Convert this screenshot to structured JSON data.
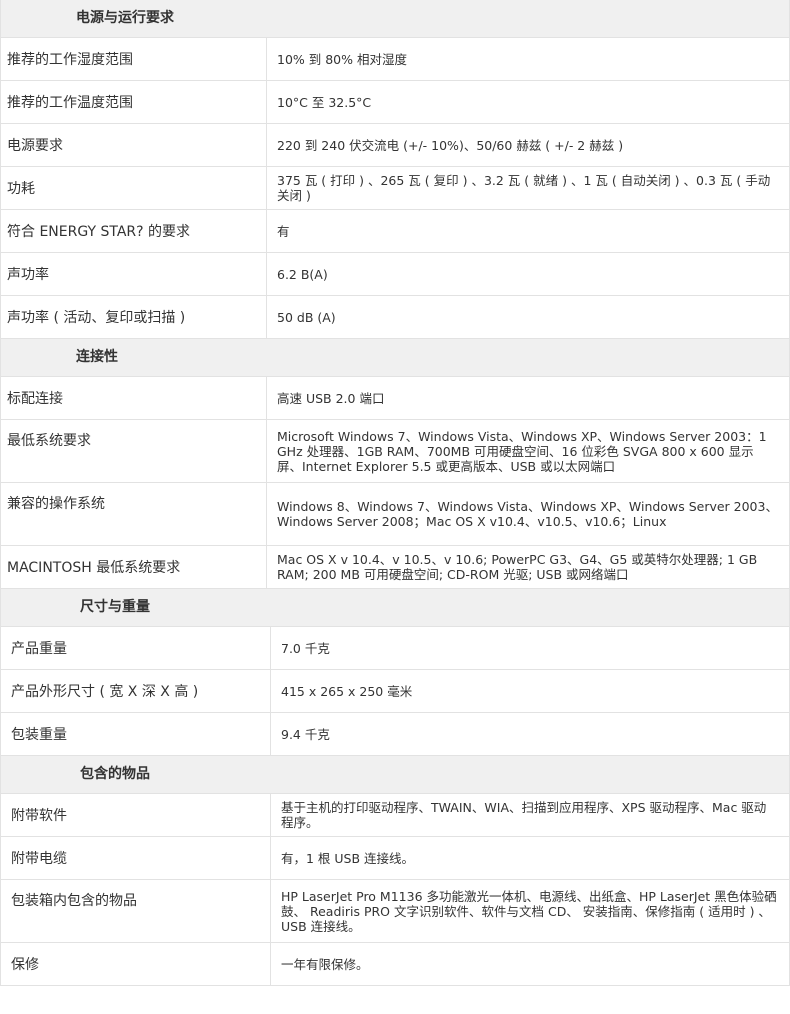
{
  "sections": [
    {
      "title": "电源与运行要求",
      "rows": [
        {
          "label": "推荐的工作湿度范围",
          "value": "10% 到 80% 相对湿度"
        },
        {
          "label": "推荐的工作温度范围",
          "value": "10°C 至 32.5°C"
        },
        {
          "label": "电源要求",
          "value": "220 到 240 伏交流电 (+/- 10%)、50/60 赫兹 ( +/- 2 赫兹 )"
        },
        {
          "label": "功耗",
          "value": "375 瓦 ( 打印 ) 、265 瓦 ( 复印 ) 、3.2 瓦 ( 就绪 ) 、1 瓦 ( 自动关闭 ) 、0.3 瓦 ( 手动关闭 )"
        },
        {
          "label": "符合 ENERGY STAR? 的要求",
          "value": "有"
        },
        {
          "label": "声功率",
          "value": "6.2 B(A)"
        },
        {
          "label": "声功率 ( 活动、复印或扫描 )",
          "value": "50 dB (A)"
        }
      ]
    },
    {
      "title": "连接性",
      "rows": [
        {
          "label": "标配连接",
          "value": "高速 USB 2.0 端口"
        },
        {
          "label": "最低系统要求",
          "value": "Microsoft Windows 7、Windows Vista、Windows XP、Windows Server 2003：1 GHz 处理器、1GB RAM、700MB 可用硬盘空间、16 位彩色 SVGA 800 x 600 显示屏、Internet Explorer 5.5 或更高版本、USB 或以太网端口"
        },
        {
          "label": "兼容的操作系统",
          "value": "Windows 8、Windows 7、Windows Vista、Windows XP、Windows Server 2003、Windows Server 2008；Mac OS X v10.4、v10.5、v10.6；Linux"
        },
        {
          "label": "MACINTOSH 最低系统要求",
          "value": "Mac OS X v 10.4、v 10.5、v 10.6; PowerPC G3、G4、G5 或英特尔处理器; 1 GB RAM; 200 MB 可用硬盘空间; CD-ROM 光驱; USB 或网络端口"
        }
      ]
    },
    {
      "title": "尺寸与重量",
      "rows": [
        {
          "label": "产品重量",
          "value": "7.0 千克"
        },
        {
          "label": "产品外形尺寸 ( 宽 X 深 X 高 )",
          "value": "415 x 265 x 250 毫米"
        },
        {
          "label": "包装重量",
          "value": "9.4 千克"
        }
      ]
    },
    {
      "title": "包含的物品",
      "rows": [
        {
          "label": "附带软件",
          "value": "基于主机的打印驱动程序、TWAIN、WIA、扫描到应用程序、XPS 驱动程序、Mac 驱动程序。"
        },
        {
          "label": "附带电缆",
          "value": "有，1 根 USB 连接线。"
        },
        {
          "label": "包装箱内包含的物品",
          "value": "HP LaserJet Pro M1136 多功能激光一体机、电源线、出纸盒、HP LaserJet 黑色体验硒鼓、 Readiris PRO 文字识别软件、软件与文档 CD、 安装指南、保修指南 ( 适用时 ) 、USB 连接线。"
        },
        {
          "label": "保修",
          "value": "一年有限保修。"
        }
      ]
    }
  ]
}
